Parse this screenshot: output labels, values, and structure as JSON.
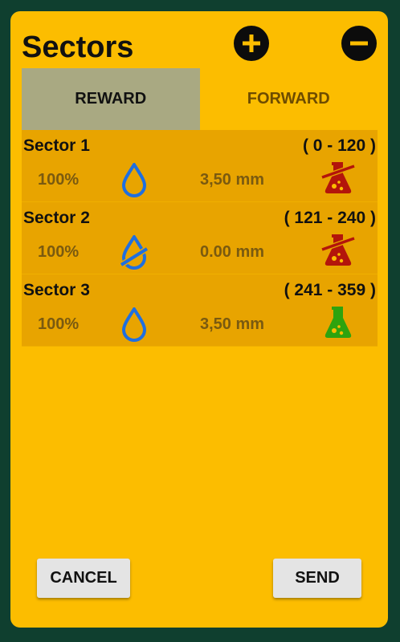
{
  "header": {
    "title": "Sectors",
    "add_icon": "plus-circle-icon",
    "remove_icon": "minus-circle-icon"
  },
  "tabs": [
    {
      "label": "REWARD",
      "active": true
    },
    {
      "label": "FORWARD",
      "active": false
    }
  ],
  "sectors": [
    {
      "name": "Sector 1",
      "range": "( 0 - 120 )",
      "percent": "100%",
      "amount": "3,50 mm",
      "water_icon": "water-drop-icon",
      "flask_icon": "flask-disabled-icon",
      "flask_color": "#b3150b"
    },
    {
      "name": "Sector 2",
      "range": "( 121 - 240 )",
      "percent": "100%",
      "amount": "0.00 mm",
      "water_icon": "water-off-icon",
      "flask_icon": "flask-disabled-icon",
      "flask_color": "#b3150b"
    },
    {
      "name": "Sector 3",
      "range": "( 241 - 359 )",
      "percent": "100%",
      "amount": "3,50 mm",
      "water_icon": "water-drop-icon",
      "flask_icon": "flask-icon",
      "flask_color": "#2ea30e"
    }
  ],
  "buttons": {
    "cancel": "CANCEL",
    "send": "SEND"
  },
  "colors": {
    "background": "#0f3f2f",
    "dialog": "#fcbd00",
    "row": "#e8a400",
    "active_tab": "#a9a982",
    "water_icon": "#1f6fe0"
  }
}
